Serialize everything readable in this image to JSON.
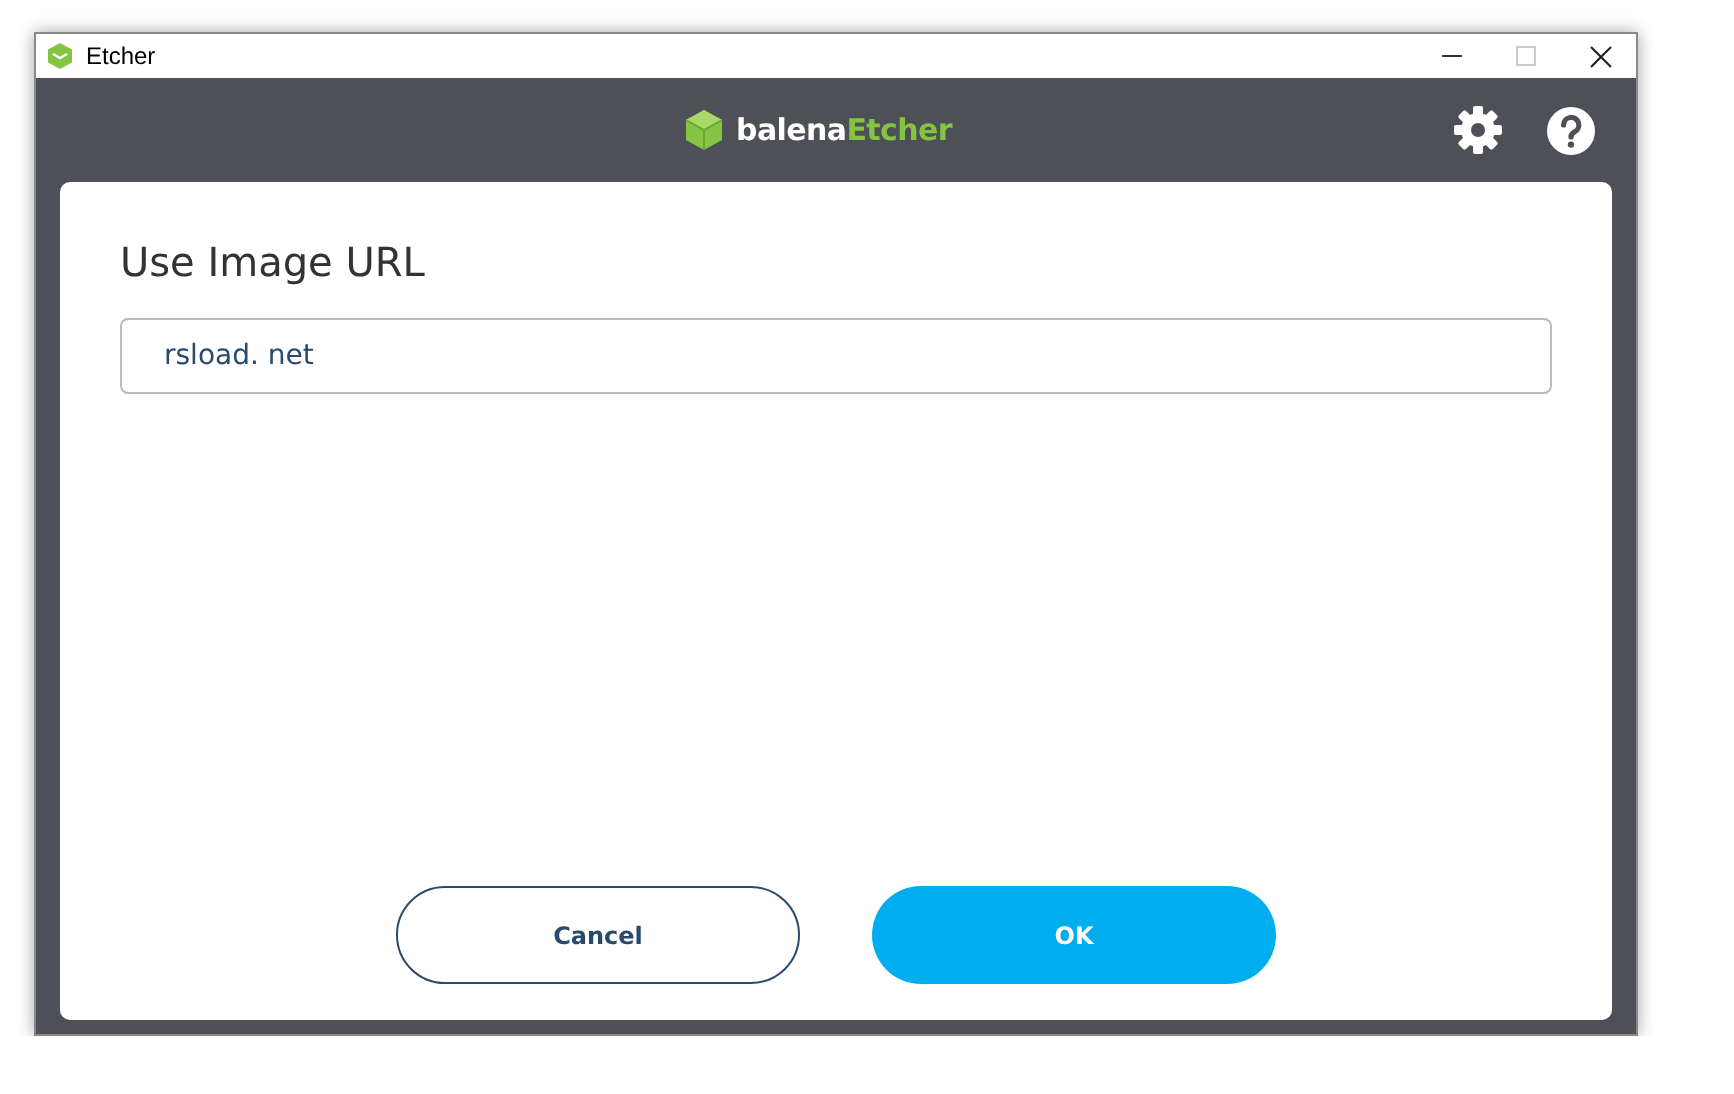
{
  "window": {
    "title": "Etcher"
  },
  "header": {
    "logo": {
      "brand": "balena",
      "product": "Etcher"
    }
  },
  "dialog": {
    "title": "Use Image URL",
    "url_field": {
      "value": "rsload. net"
    },
    "buttons": [
      {
        "label": "Cancel",
        "kind": "secondary"
      },
      {
        "label": "OK",
        "kind": "primary"
      }
    ]
  }
}
